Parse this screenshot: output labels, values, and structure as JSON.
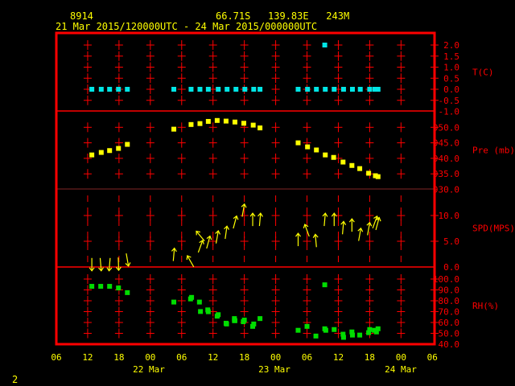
{
  "header": {
    "station": "8914",
    "location": "66.71S   139.83E   243M",
    "period": "21 Mar 2015/120000UTC - 24 Mar 2015/000000UTC"
  },
  "footer": {
    "page_number": "2"
  },
  "colors": {
    "frame": "#ff0000",
    "text": "#ffff00",
    "temp": "#00e5e5",
    "pressure": "#ffff00",
    "wind": "#ffff00",
    "rh": "#00dd00"
  },
  "chart_data": {
    "type": "scatter",
    "title": "8914  66.71S 139.83E 243M  21 Mar 2015/120000UTC - 24 Mar 2015/000000UTC",
    "x_units": "hours since 21 Mar 2015 00UTC",
    "xlim": [
      6,
      78
    ],
    "x_ticks": [
      {
        "hour": 6,
        "label": "06"
      },
      {
        "hour": 12,
        "label": "12"
      },
      {
        "hour": 18,
        "label": "18"
      },
      {
        "hour": 24,
        "label": "00"
      },
      {
        "hour": 30,
        "label": "06"
      },
      {
        "hour": 36,
        "label": "12"
      },
      {
        "hour": 42,
        "label": "18"
      },
      {
        "hour": 48,
        "label": "00"
      },
      {
        "hour": 54,
        "label": "06"
      },
      {
        "hour": 60,
        "label": "12"
      },
      {
        "hour": 66,
        "label": "18"
      },
      {
        "hour": 72,
        "label": "00"
      },
      {
        "hour": 78,
        "label": "06"
      }
    ],
    "date_labels": [
      {
        "hour": 36,
        "label": "22 Mar"
      },
      {
        "hour": 60,
        "label": "23 Mar"
      },
      {
        "hour": 72,
        "label": "24 Mar"
      }
    ],
    "panels": [
      {
        "name": "temperature",
        "ylabel": "T(C)",
        "ylim": [
          -1.0,
          2.5
        ],
        "ticks": [
          "2.0",
          "1.5",
          "1.0",
          "0.5",
          "0.0",
          "-0.5",
          "-1.0"
        ],
        "points": [
          [
            12.8,
            0
          ],
          [
            14.6,
            0
          ],
          [
            16.2,
            0
          ],
          [
            17.9,
            0
          ],
          [
            19.6,
            0
          ],
          [
            28.5,
            0
          ],
          [
            31.8,
            0
          ],
          [
            33.5,
            0
          ],
          [
            35.1,
            0
          ],
          [
            37.0,
            0
          ],
          [
            38.7,
            0
          ],
          [
            40.4,
            0
          ],
          [
            42.1,
            0
          ],
          [
            43.8,
            0
          ],
          [
            45.0,
            0
          ],
          [
            52.3,
            0
          ],
          [
            54.1,
            0
          ],
          [
            55.8,
            0
          ],
          [
            57.4,
            2.0
          ],
          [
            57.5,
            0
          ],
          [
            59.2,
            0
          ],
          [
            61.0,
            0
          ],
          [
            62.7,
            0
          ],
          [
            64.2,
            0
          ],
          [
            66.0,
            0
          ],
          [
            67.0,
            0
          ],
          [
            67.6,
            0
          ]
        ]
      },
      {
        "name": "pressure",
        "ylabel": "Pre (mb)",
        "ylim": [
          930,
          955
        ],
        "ticks": [
          "950.0",
          "945.0",
          "940.0",
          "935.0",
          "930.0"
        ],
        "points": [
          [
            12.8,
            941.1
          ],
          [
            14.6,
            941.9
          ],
          [
            16.2,
            942.5
          ],
          [
            17.9,
            943.2
          ],
          [
            19.6,
            944.5
          ],
          [
            28.5,
            949.4
          ],
          [
            31.8,
            950.9
          ],
          [
            33.5,
            951.2
          ],
          [
            35.1,
            951.9
          ],
          [
            36.8,
            952.2
          ],
          [
            38.5,
            952.0
          ],
          [
            40.2,
            951.7
          ],
          [
            41.9,
            951.3
          ],
          [
            43.7,
            950.7
          ],
          [
            45.0,
            949.8
          ],
          [
            52.3,
            945.0
          ],
          [
            54.1,
            943.7
          ],
          [
            55.8,
            942.7
          ],
          [
            57.5,
            941.1
          ],
          [
            59.1,
            940.3
          ],
          [
            60.9,
            938.8
          ],
          [
            62.6,
            937.7
          ],
          [
            64.1,
            936.7
          ],
          [
            65.8,
            935.2
          ],
          [
            67.1,
            934.4
          ],
          [
            67.6,
            934.1
          ]
        ]
      },
      {
        "name": "wind_speed",
        "ylabel": "SPD(MPS)",
        "ylim": [
          0,
          15
        ],
        "ticks": [
          "10.0",
          "5.0",
          "0.0"
        ],
        "points_hour_speed_direction": [
          [
            12.8,
            0.5,
            180
          ],
          [
            14.5,
            0.5,
            175
          ],
          [
            16.2,
            0.5,
            185
          ],
          [
            17.9,
            0.6,
            178
          ],
          [
            19.6,
            1.4,
            170
          ],
          [
            28.5,
            2.4,
            5
          ],
          [
            31.7,
            1.1,
            330
          ],
          [
            33.6,
            4.0,
            20
          ],
          [
            33.6,
            6.0,
            320
          ],
          [
            35.1,
            4.8,
            15
          ],
          [
            36.8,
            5.8,
            10
          ],
          [
            38.5,
            6.7,
            8
          ],
          [
            40.2,
            8.7,
            15
          ],
          [
            41.8,
            11.0,
            10
          ],
          [
            43.6,
            9.2,
            0
          ],
          [
            45.0,
            9.2,
            5
          ],
          [
            52.3,
            5.3,
            0
          ],
          [
            54.0,
            7.1,
            340
          ],
          [
            55.7,
            5.1,
            355
          ],
          [
            57.4,
            9.2,
            5
          ],
          [
            59.2,
            9.2,
            0
          ],
          [
            60.9,
            7.6,
            5
          ],
          [
            62.6,
            8.1,
            0
          ],
          [
            64.1,
            6.3,
            10
          ],
          [
            65.8,
            7.4,
            10
          ],
          [
            67.0,
            8.7,
            20
          ],
          [
            67.5,
            8.4,
            15
          ]
        ]
      },
      {
        "name": "relative_humidity",
        "ylabel": "RH(%)",
        "ylim": [
          40,
          105
        ],
        "ticks": [
          "100.0",
          "90.0",
          "80.0",
          "70.0",
          "60.0",
          "50.0",
          "40.0"
        ],
        "points": [
          [
            12.8,
            93.3
          ],
          [
            14.5,
            93.3
          ],
          [
            16.2,
            93.3
          ],
          [
            17.9,
            91.8
          ],
          [
            19.6,
            87.5
          ],
          [
            28.5,
            78.8
          ],
          [
            31.7,
            81.7
          ],
          [
            31.9,
            83.1
          ],
          [
            33.4,
            78.8
          ],
          [
            33.6,
            70.1
          ],
          [
            35.0,
            71.6
          ],
          [
            35.1,
            69.9
          ],
          [
            36.8,
            65.8
          ],
          [
            37.0,
            67.2
          ],
          [
            38.5,
            59.3
          ],
          [
            38.6,
            58.6
          ],
          [
            40.1,
            61.7
          ],
          [
            40.2,
            61.7
          ],
          [
            40.1,
            63.6
          ],
          [
            41.8,
            60.7
          ],
          [
            42.0,
            62.2
          ],
          [
            43.6,
            56.4
          ],
          [
            43.8,
            58.6
          ],
          [
            45.0,
            63.6
          ],
          [
            52.3,
            52.8
          ],
          [
            54.0,
            56.4
          ],
          [
            55.7,
            47.5
          ],
          [
            57.4,
            94.7
          ],
          [
            57.4,
            54.2
          ],
          [
            57.6,
            52.8
          ],
          [
            59.2,
            53.5
          ],
          [
            60.9,
            49.2
          ],
          [
            61.0,
            46.3
          ],
          [
            62.6,
            51.3
          ],
          [
            62.7,
            48.4
          ],
          [
            64.1,
            48.4
          ],
          [
            65.8,
            50.6
          ],
          [
            66.0,
            53.5
          ],
          [
            66.9,
            52.8
          ],
          [
            67.3,
            51.3
          ],
          [
            67.6,
            54.2
          ]
        ]
      }
    ]
  }
}
